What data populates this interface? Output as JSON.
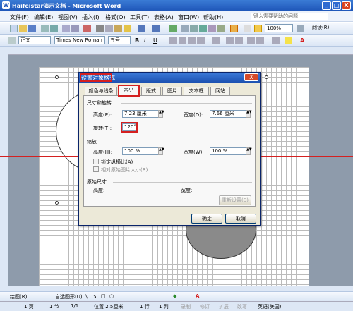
{
  "window": {
    "title": "Haifeistar演示文档 - Microsoft Word",
    "app_icon": "W",
    "min_label": "_",
    "max_label": "□",
    "close_label": "X"
  },
  "menu": {
    "items": [
      "文件(F)",
      "编辑(E)",
      "视图(V)",
      "插入(I)",
      "格式(O)",
      "工具(T)",
      "表格(A)",
      "窗口(W)",
      "帮助(H)"
    ],
    "help_placeholder": "键入需要帮助的问题"
  },
  "toolbar": {
    "zoom": "100%",
    "read_label": "阅读(R)"
  },
  "format": {
    "style": "正文",
    "font": "Times New Roman",
    "size": "五号"
  },
  "dialog": {
    "title": "设置对象格式",
    "close_label": "X",
    "tabs": [
      "颜色与线条",
      "大小",
      "版式",
      "图片",
      "文本框",
      "网站"
    ],
    "size_rotate_section": "尺寸和旋转",
    "height_label": "高度(E):",
    "height_value": "7.23 厘米",
    "width_label": "宽度(D):",
    "width_value": "7.66 厘米",
    "rotate_label": "旋转(T):",
    "rotate_value": "120°",
    "scale_section": "缩放",
    "scale_height_label": "高度(H):",
    "scale_height_value": "100 %",
    "scale_width_label": "宽度(W):",
    "scale_width_value": "100 %",
    "lock_ratio_label": "锁定纵横比(A)",
    "relative_label": "相对原始图片大小(R)",
    "original_section": "原始尺寸",
    "orig_height_label": "高度:",
    "orig_width_label": "宽度:",
    "reset_label": "重新设置(S)",
    "ok_label": "确定",
    "cancel_label": "取消"
  },
  "drawbar": {
    "draw_label": "绘图(R)",
    "autoshape_label": "自选图形(U)"
  },
  "status": {
    "page": "1 页",
    "section": "1 节",
    "pages": "1/1",
    "position": "位置 2.5厘米",
    "line": "1 行",
    "col": "1 列",
    "rec": "录制",
    "trk": "修订",
    "ext": "扩展",
    "ovr": "改写",
    "lang": "英语(美国)"
  },
  "colors": {
    "title": "#1e55b8",
    "accent_red": "#d42020"
  }
}
